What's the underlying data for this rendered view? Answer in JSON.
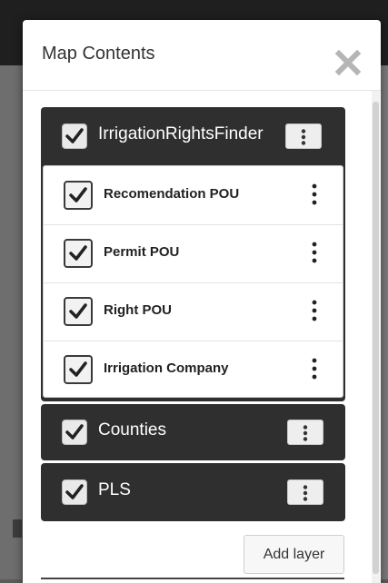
{
  "dialog": {
    "title": "Map Contents",
    "close_icon": "close-icon"
  },
  "groups": [
    {
      "label": "IrrigationRightsFinder",
      "checked": true,
      "items": [
        {
          "label": "Recomendation POU",
          "checked": true
        },
        {
          "label": "Permit POU",
          "checked": true
        },
        {
          "label": "Right POU",
          "checked": true
        },
        {
          "label": "Irrigation Company",
          "checked": true
        }
      ]
    },
    {
      "label": "Counties",
      "checked": true
    },
    {
      "label": "PLS",
      "checked": true
    }
  ],
  "footer": {
    "add_layer_label": "Add layer"
  },
  "colors": {
    "group_bg": "#2f2f2f",
    "check_mark": "#222222",
    "dialog_bg": "#ffffff"
  }
}
